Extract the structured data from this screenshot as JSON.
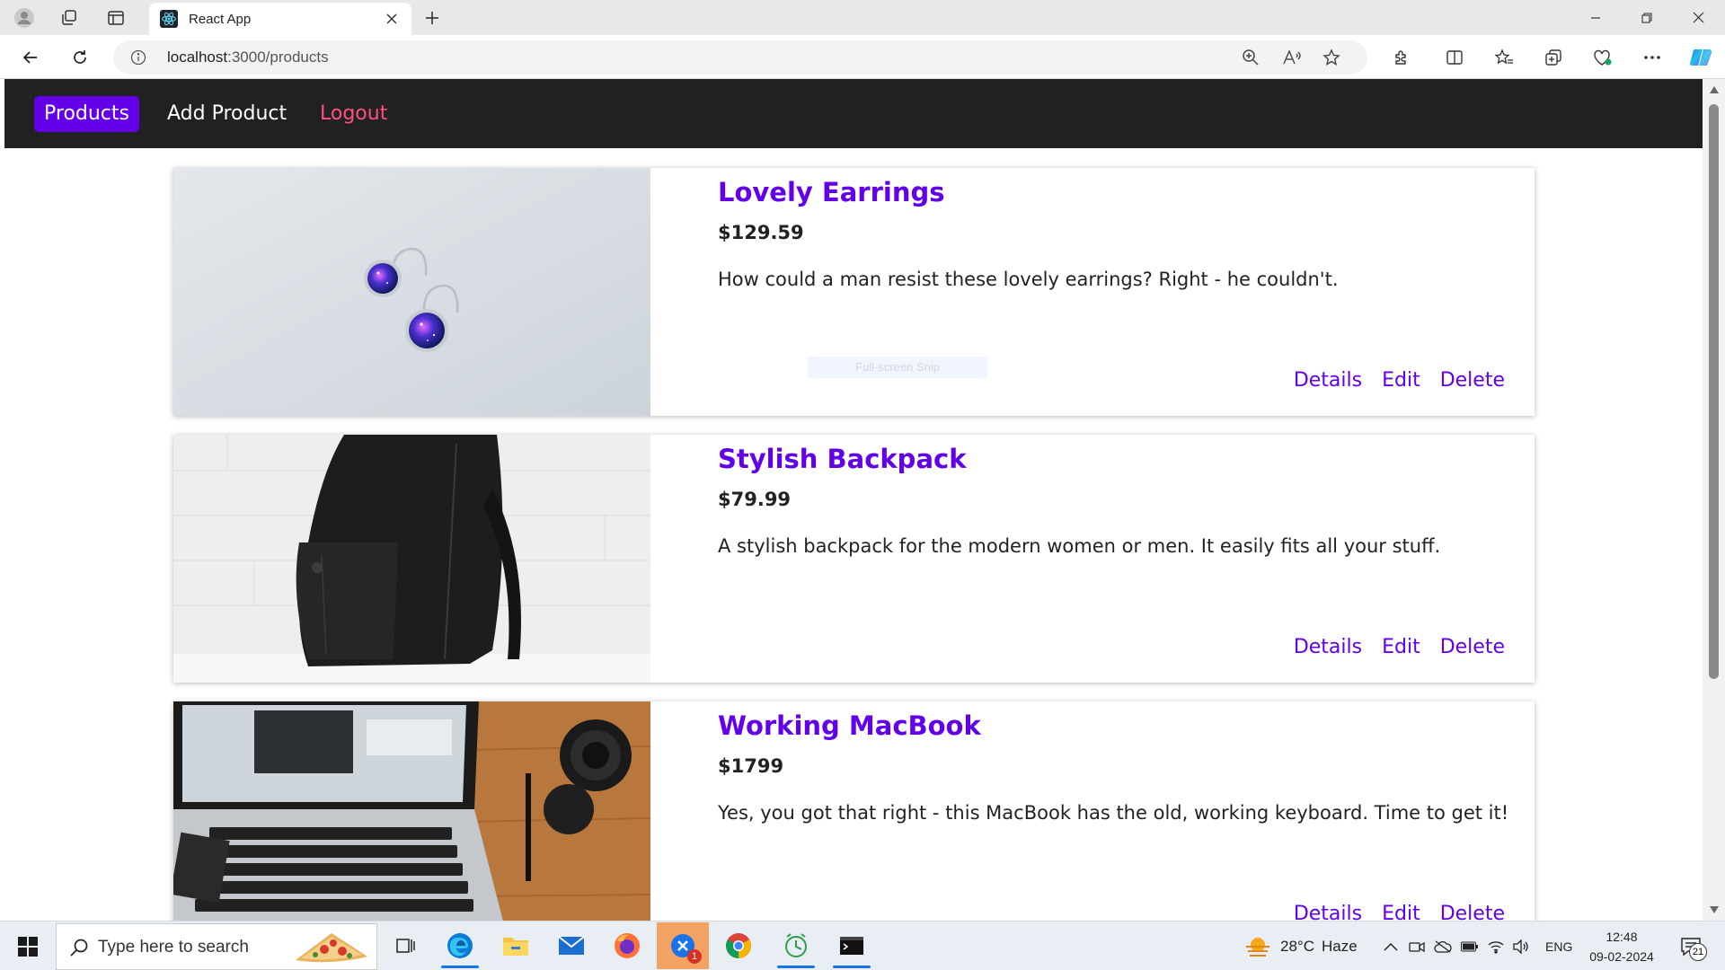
{
  "browser": {
    "tab_title": "React App",
    "url_host": "localhost",
    "url_path": ":3000/products"
  },
  "navbar": {
    "items": [
      {
        "label": "Products",
        "active": true
      },
      {
        "label": "Add Product",
        "active": false
      },
      {
        "label": "Logout",
        "active": false
      }
    ]
  },
  "products": [
    {
      "title": "Lovely Earrings",
      "price": "$129.59",
      "description": "How could a man resist these lovely earrings? Right - he couldn't.",
      "actions": [
        "Details",
        "Edit",
        "Delete"
      ]
    },
    {
      "title": "Stylish Backpack",
      "price": "$79.99",
      "description": "A stylish backpack for the modern women or men. It easily fits all your stuff.",
      "actions": [
        "Details",
        "Edit",
        "Delete"
      ]
    },
    {
      "title": "Working MacBook",
      "price": "$1799",
      "description": "Yes, you got that right - this MacBook has the old, working keyboard. Time to get it!",
      "actions": [
        "Details",
        "Edit",
        "Delete"
      ]
    }
  ],
  "overlay": {
    "snip_label": "Full-screen Snip"
  },
  "taskbar": {
    "search_placeholder": "Type here to search",
    "weather_temp": "28°C",
    "weather_text": "Haze",
    "language": "ENG",
    "time": "12:48",
    "date": "09-02-2024",
    "notification_count": "21",
    "snip_badge": "1"
  },
  "colors": {
    "accent": "#6200ea",
    "navbar_bg": "#212121",
    "logout": "#ff4f81"
  }
}
